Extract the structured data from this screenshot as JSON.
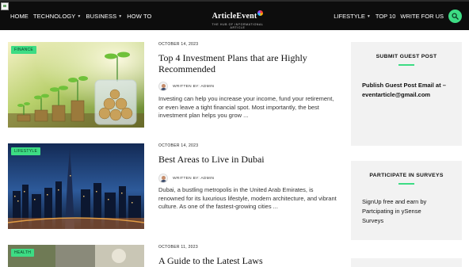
{
  "header": {
    "nav_left": [
      {
        "label": "HOME",
        "has_dropdown": false
      },
      {
        "label": "TECHNOLOGY",
        "has_dropdown": true
      },
      {
        "label": "BUSINESS",
        "has_dropdown": true
      },
      {
        "label": "HOW TO",
        "has_dropdown": false
      }
    ],
    "logo_text": "ArticleEvent",
    "logo_tagline": "THE HUB OF INFORMATIONAL ARTICLE",
    "nav_right": [
      {
        "label": "LIFESTYLE",
        "has_dropdown": true
      },
      {
        "label": "TOP 10",
        "has_dropdown": false
      },
      {
        "label": "WRITE FOR US",
        "has_dropdown": false
      }
    ],
    "search_icon": "search-icon"
  },
  "posts": [
    {
      "category": "FINANCE",
      "date": "OCTOBER 14, 2023",
      "title": "Top 4 Investment Plans that are Highly Recommended",
      "author": "WRITTEN BY: ADMIN",
      "excerpt": "Investing can help you increase your income, fund your retirement, or even leave a tight financial spot. Most importantly, the best investment plan helps you grow ..."
    },
    {
      "category": "LIFESTYLE",
      "date": "OCTOBER 14, 2023",
      "title": "Best Areas to Live in Dubai",
      "author": "WRITTEN BY: ADMIN",
      "excerpt": "Dubai, a bustling metropolis in the United Arab Emirates, is renowned for its luxurious lifestyle, modern architecture, and vibrant culture. As one of the fastest-growing cities ..."
    },
    {
      "category": "HEALTH",
      "date": "OCTOBER 11, 2023",
      "title": "A Guide to the Latest Laws"
    }
  ],
  "sidebar": {
    "guest_post": {
      "title": "SUBMIT GUEST POST",
      "line1": "Publish Guest Post Email at –",
      "line2": "eventarticle@gmail.com"
    },
    "surveys": {
      "title": "PARTICIPATE IN SURVEYS",
      "line1": "SignUp free and earn by",
      "line2": "Partcipating in ySense",
      "line3": "Surveys"
    }
  },
  "colors": {
    "accent": "#3ddc84",
    "header_bg": "#0d0d0d",
    "widget_bg": "#f2f2f2"
  }
}
